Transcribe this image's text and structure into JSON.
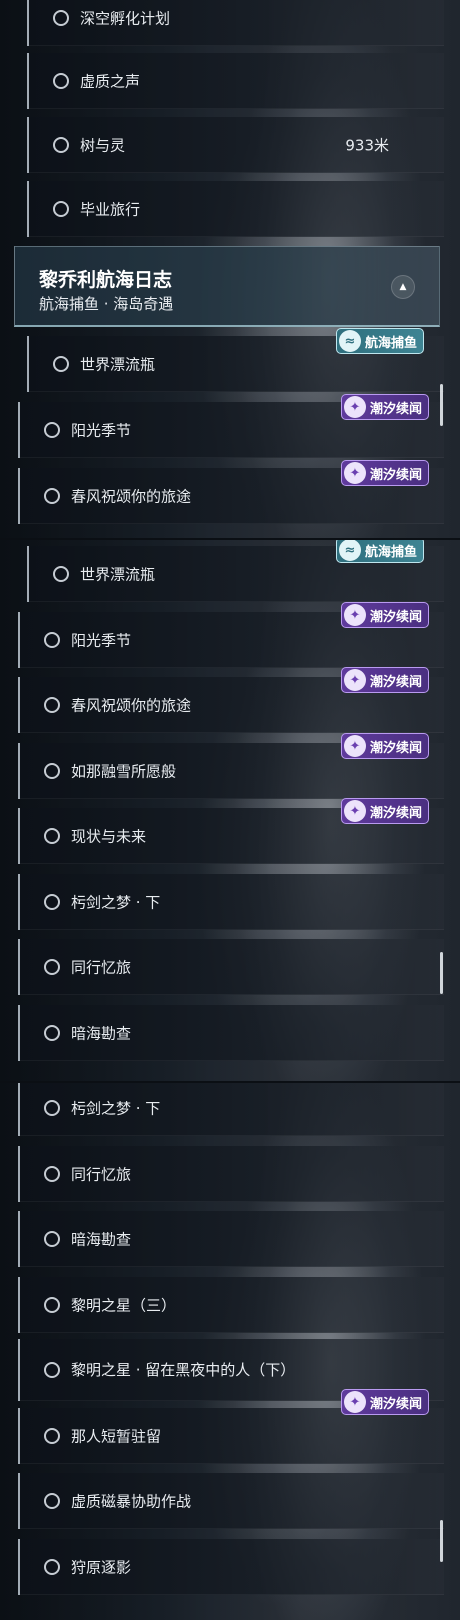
{
  "panels": [
    {
      "items": [
        {
          "label": "深空孵化计划"
        },
        {
          "label": "虚质之声"
        },
        {
          "label": "树与灵",
          "distance": "933米"
        },
        {
          "label": "毕业旅行"
        }
      ],
      "header": {
        "title": "黎乔利航海日志",
        "subtitle": "航海捕鱼 · 海岛奇遇",
        "collapse_icon": "▲"
      },
      "items_after": [
        {
          "label": "世界漂流瓶",
          "badge": "航海捕鱼"
        },
        {
          "label": "阳光季节",
          "badge": "潮汐续闻"
        },
        {
          "label": "春风祝颂你的旅途",
          "badge": "潮汐续闻"
        }
      ]
    },
    {
      "items": [
        {
          "label": "世界漂流瓶",
          "badge": "航海捕鱼"
        },
        {
          "label": "阳光季节",
          "badge": "潮汐续闻"
        },
        {
          "label": "春风祝颂你的旅途",
          "badge": "潮汐续闻"
        },
        {
          "label": "如那融雪所愿般",
          "badge": "潮汐续闻"
        },
        {
          "label": "现状与未来",
          "badge": "潮汐续闻"
        },
        {
          "label": "杇剑之梦 · 下"
        },
        {
          "label": "同行忆旅"
        },
        {
          "label": "暗海勘查"
        }
      ]
    },
    {
      "items": [
        {
          "label": "杇剑之梦 · 下"
        },
        {
          "label": "同行忆旅"
        },
        {
          "label": "暗海勘查"
        },
        {
          "label": "黎明之星（三）"
        },
        {
          "label": "黎明之星 · 留在黑夜中的人（下）"
        },
        {
          "label": "那人短暂驻留",
          "badge": "潮汐续闻"
        },
        {
          "label": "虚质磁暴协助作战"
        },
        {
          "label": "狩原逐影"
        }
      ]
    }
  ],
  "badge_icons": {
    "purple": "wave-sparkle-icon",
    "teal": "fish-wave-icon"
  },
  "colors": {
    "purple_badge": "#5f3a9c",
    "teal_badge": "#2f6f7e",
    "header_accent": "#aad7e1"
  }
}
